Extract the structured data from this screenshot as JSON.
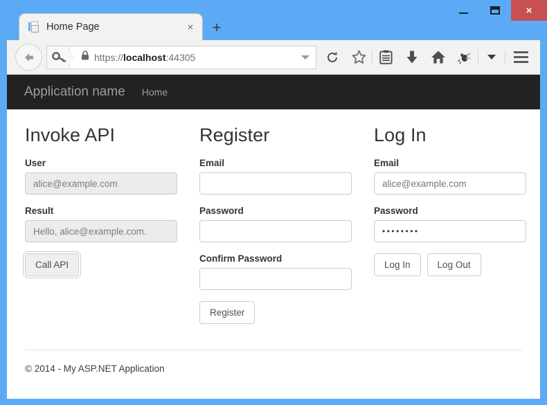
{
  "window": {
    "chrome_color": "#5caaf5",
    "minimize_label": "Minimize",
    "maximize_label": "Maximize",
    "close_label": "×"
  },
  "browser": {
    "tab": {
      "title": "Home Page",
      "favicon": "page-icon",
      "close_label": "×"
    },
    "new_tab_label": "+",
    "address": {
      "scheme": "https://",
      "host": "localhost",
      "port": ":44305",
      "full_url": "https://localhost:44305",
      "security_icon": "lock-icon",
      "identity_icon": "key-icon"
    },
    "toolbar_icons": [
      "back-icon",
      "reload-icon",
      "bookmark-star-icon",
      "reading-list-icon",
      "download-icon",
      "home-icon",
      "bug-icon",
      "chevron-down-icon",
      "hamburger-menu-icon"
    ]
  },
  "site": {
    "navbar": {
      "brand": "Application name",
      "links": [
        {
          "label": "Home"
        }
      ]
    },
    "columns": {
      "invoke_api": {
        "heading": "Invoke API",
        "user_label": "User",
        "user_value": "alice@example.com",
        "result_label": "Result",
        "result_value": "Hello, alice@example.com.",
        "call_button": "Call API"
      },
      "register": {
        "heading": "Register",
        "email_label": "Email",
        "email_value": "",
        "password_label": "Password",
        "password_value": "",
        "confirm_label": "Confirm Password",
        "confirm_value": "",
        "register_button": "Register"
      },
      "login": {
        "heading": "Log In",
        "email_label": "Email",
        "email_value": "alice@example.com",
        "password_label": "Password",
        "password_value": "••••••••",
        "login_button": "Log In",
        "logout_button": "Log Out"
      }
    },
    "footer": "© 2014 - My ASP.NET Application"
  }
}
